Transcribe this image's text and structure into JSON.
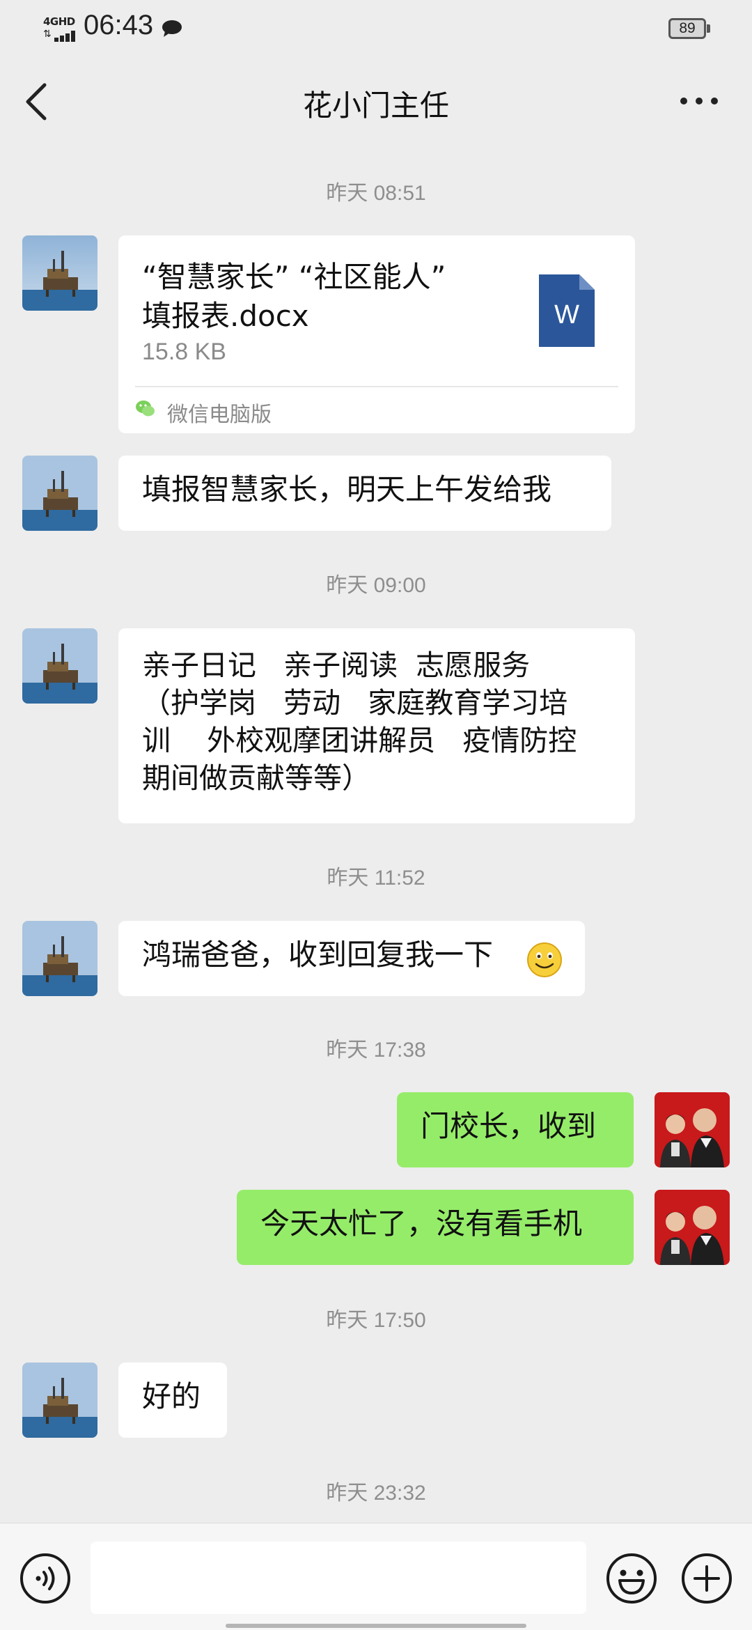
{
  "status_bar": {
    "network": "4GHD",
    "time": "06:43",
    "battery": "89"
  },
  "nav": {
    "title": "花小门主任"
  },
  "messages": {
    "t1": "昨天 08:51",
    "file": {
      "name_line1": "“智慧家长” “社区能人”",
      "name_line2": "填报表.docx",
      "size": "15.8 KB",
      "icon_letter": "W",
      "source": "微信电脑版"
    },
    "m1": "填报智慧家长，明天上午发给我",
    "t2": "昨天 09:00",
    "m2": "亲子日记   亲子阅读  志愿服务\n（护学岗   劳动   家庭教育学习培\n训    外校观摩团讲解员   疫情防控\n期间做贡献等等）",
    "t3": "昨天 11:52",
    "m3": "鸿瑞爸爸，收到回复我一下",
    "t4": "昨天 17:38",
    "m4": "门校长，收到",
    "m5": "今天太忙了，没有看手机",
    "t5": "昨天 17:50",
    "m6": "好的",
    "t6": "昨天 23:32"
  },
  "icons": {
    "back": "chevron-left-icon",
    "more": "more-dots-icon",
    "voice": "voice-icon",
    "emoji": "emoji-icon",
    "plus": "plus-icon"
  },
  "colors": {
    "background": "#ededed",
    "incoming_bubble": "#ffffff",
    "outgoing_bubble": "#95ec69",
    "time_label": "#8e8e8e",
    "word_icon": "#2b579a"
  }
}
